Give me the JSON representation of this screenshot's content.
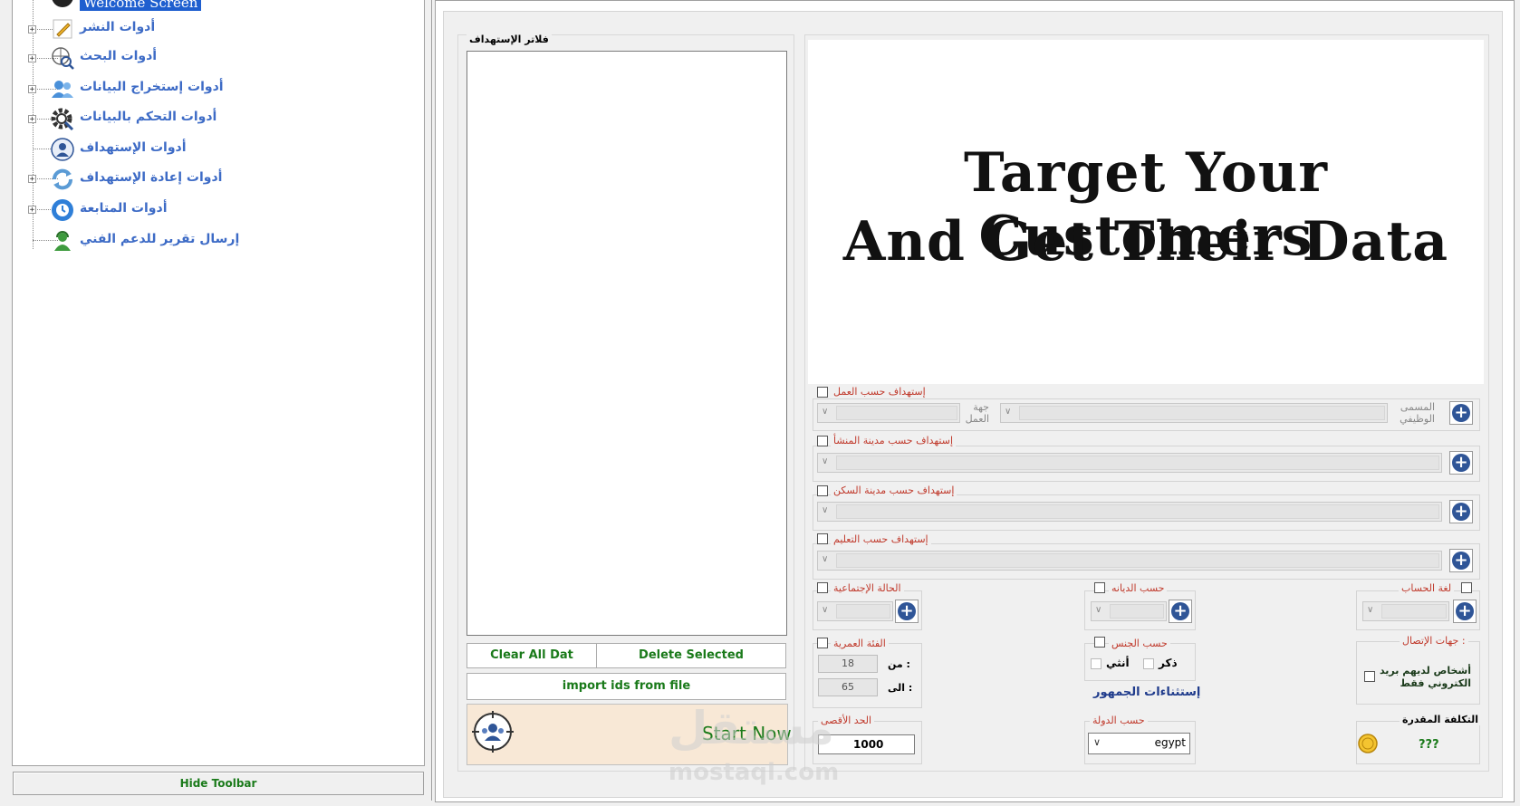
{
  "sidebar": {
    "selected_item": "Welcome Screen",
    "items": [
      {
        "label": "أدوات النشر",
        "icon": "pencil-icon",
        "expandable": true
      },
      {
        "label": "أدوات البحث",
        "icon": "globe-search-icon",
        "expandable": true
      },
      {
        "label": "أدوات إستخراج البيانات",
        "icon": "users-icon",
        "expandable": true
      },
      {
        "label": "أدوات التحكم بالبيانات",
        "icon": "gear-search-icon",
        "expandable": true
      },
      {
        "label": "أدوات الإستهداف",
        "icon": "target-user-icon",
        "expandable": false
      },
      {
        "label": "أدوات إعادة الإستهداف",
        "icon": "refresh-icon",
        "expandable": true
      },
      {
        "label": "أدوات المتابعة",
        "icon": "clock-icon",
        "expandable": true
      },
      {
        "label": "إرسال تقرير للدعم الفني",
        "icon": "support-user-icon",
        "expandable": false
      }
    ],
    "hide_toolbar_label": "Hide Toolbar"
  },
  "filters": {
    "legend": "فلاتر الإستهداف",
    "clear_label": "Clear All Dat",
    "delete_label": "Delete Selected",
    "import_label": "import ids from file",
    "start_label": "Start Now"
  },
  "banner": {
    "line1": "Target Your Customers",
    "line2": "And Get Their Data"
  },
  "targeting": {
    "by_work": {
      "label": "إستهداف حسب العمل",
      "employer_label": "جهة العمل",
      "job_title_label": "المسمى الوظيفي"
    },
    "by_hometown": {
      "label": "إستهداف حسب مدينة المنشأ"
    },
    "by_residence": {
      "label": "إستهداف حسب مدينة السكن"
    },
    "by_education": {
      "label": "إستهداف حسب التعليم"
    },
    "marital_status": {
      "label": "الحالة الإجتماعية"
    },
    "religion": {
      "label": "حسب الديانه"
    },
    "account_language": {
      "label": "لغة الحساب"
    },
    "age_group": {
      "label": "الفئة العمرية",
      "from_label": "من :",
      "to_label": "الى :",
      "from_value": "18",
      "to_value": "65"
    },
    "gender": {
      "label": "حسب الجنس",
      "male_label": "ذكر",
      "female_label": "أنثي"
    },
    "contacts": {
      "label": "جهات الإتصال :",
      "email_only_label": "أشخاص لديهم بريد الكتروني فقط"
    },
    "audience_exclusions": "إستثناءات الجمهور",
    "max_limit": {
      "label": "الحد الأقصى",
      "value": "1000"
    },
    "country": {
      "label": "حسب الدولة",
      "value": "egypt"
    },
    "estimated_cost": {
      "label": "التكلفة المقدرة",
      "value": "???"
    }
  },
  "watermark": {
    "arabic": "مستقل",
    "latin": "mostaql.com"
  },
  "colors": {
    "tree_text": "#3d6bc6",
    "selected_bg": "#1f5fcf",
    "green_text": "#1a7a1a",
    "red_label": "#c0392b",
    "add_button": "#2f5597",
    "start_bg": "#f8e8d6"
  }
}
